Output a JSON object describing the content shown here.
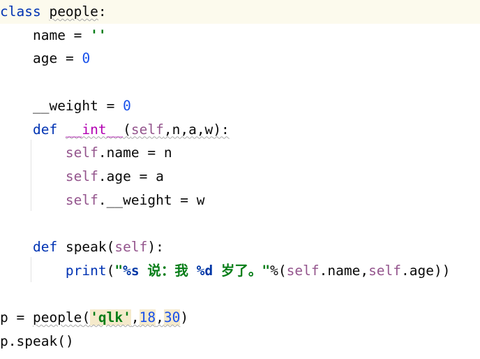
{
  "editor": {
    "language": "Python",
    "lines": [
      {
        "indent": 0,
        "text": "class people:"
      },
      {
        "indent": 1,
        "text": "name = ''"
      },
      {
        "indent": 1,
        "text": "age = 0"
      },
      {
        "indent": 0,
        "text": ""
      },
      {
        "indent": 1,
        "text": "__weight = 0"
      },
      {
        "indent": 1,
        "text": "def __int__(self,n,a,w):"
      },
      {
        "indent": 2,
        "text": "self.name = n"
      },
      {
        "indent": 2,
        "text": "self.age = a"
      },
      {
        "indent": 2,
        "text": "self.__weight = w"
      },
      {
        "indent": 0,
        "text": ""
      },
      {
        "indent": 1,
        "text": "def speak(self):"
      },
      {
        "indent": 2,
        "text": "print(\"%s 说：我 %d 岁了。\"%(self.name,self.age))"
      },
      {
        "indent": 0,
        "text": ""
      },
      {
        "indent": 0,
        "text": "p = people('qlk',18,30)"
      },
      {
        "indent": 0,
        "text": "p.speak()"
      }
    ]
  },
  "tokens": {
    "class_kw": "class",
    "class_name": "people",
    "colon": ":",
    "name_var": "name",
    "eq": " = ",
    "empty_str": "''",
    "age_var": "age",
    "zero": "0",
    "weight_var": "__weight",
    "def_kw": "def",
    "int_name": "__int__",
    "lparen": "(",
    "rparen": ")",
    "self_kw": "self",
    "params_rest": ",n,a,w",
    "paren_colon": "):",
    "dot": ".",
    "n_var": "n",
    "a_var": "a",
    "w_var": "w",
    "speak_name": "speak",
    "print_fn": "print",
    "fmt_s": "%s",
    "say_text": "说：我",
    "fmt_d": "%d",
    "age_text": "岁了。",
    "quote": "\"",
    "percent": "%",
    "comma": ",",
    "close_parens": "))",
    "p_var": "p",
    "qlk_str": "'qlk'",
    "num18": "18",
    "num30": "30",
    "call_parens": "()"
  }
}
